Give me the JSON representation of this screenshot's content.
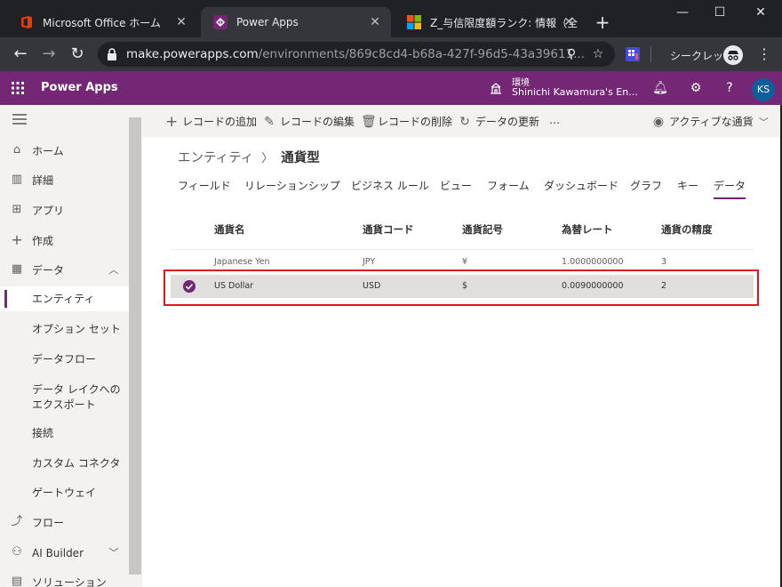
{
  "browser": {
    "tabs": [
      {
        "title": "Microsoft Office ホーム",
        "active": false
      },
      {
        "title": "Power Apps",
        "active": true
      },
      {
        "title": "Z_与信限度額ランク: 情報（全",
        "active": false
      }
    ],
    "url_host": "make.powerapps.com",
    "url_path": "/environments/869c8cd4-b68a-427f-96d5-43a39611...",
    "incognito_label": "シークレット"
  },
  "header": {
    "app_name": "Power Apps",
    "env_label": "環境",
    "env_value": "Shinichi Kawamura's En...",
    "avatar_initials": "KS"
  },
  "nav": {
    "items": [
      {
        "label": "ホーム",
        "icon": "home-icon"
      },
      {
        "label": "詳細",
        "icon": "book-icon"
      },
      {
        "label": "アプリ",
        "icon": "apps-icon"
      },
      {
        "label": "作成",
        "icon": "plus-icon"
      },
      {
        "label": "データ",
        "icon": "table-icon"
      },
      {
        "label": "エンティティ",
        "selected": true
      },
      {
        "label": "オプション セット"
      },
      {
        "label": "データフロー"
      },
      {
        "label": "データ レイクへのエクスポート"
      },
      {
        "label": "接続"
      },
      {
        "label": "カスタム コネクタ"
      },
      {
        "label": "ゲートウェイ"
      },
      {
        "label": "フロー",
        "icon": "flow-icon"
      },
      {
        "label": "AI Builder",
        "icon": "ai-builder-icon"
      },
      {
        "label": "ソリューション",
        "icon": "solution-icon"
      }
    ]
  },
  "commands": {
    "add_record": "レコードの追加",
    "edit_record": "レコードの編集",
    "delete_record": "レコードの削除",
    "refresh": "データの更新",
    "more": "…",
    "view_selector": "アクティブな通貨"
  },
  "breadcrumb": {
    "parent": "エンティティ",
    "current": "通貨型"
  },
  "tabs": [
    "フィールド",
    "リレーションシップ",
    "ビジネス ルール",
    "ビュー",
    "フォーム",
    "ダッシュボード",
    "グラフ",
    "キー",
    "データ"
  ],
  "grid": {
    "columns": [
      "通貨名",
      "通貨コード",
      "通貨記号",
      "為替レート",
      "通貨の精度"
    ],
    "rows": [
      {
        "cells": [
          "Japanese Yen",
          "JPY",
          "¥",
          "1.0000000000",
          "3"
        ],
        "selected": false
      },
      {
        "cells": [
          "US Dollar",
          "USD",
          "$",
          "0.0090000000",
          "2"
        ],
        "selected": true
      }
    ]
  },
  "colors": {
    "brand": "#742774",
    "highlight": "#e81123"
  }
}
